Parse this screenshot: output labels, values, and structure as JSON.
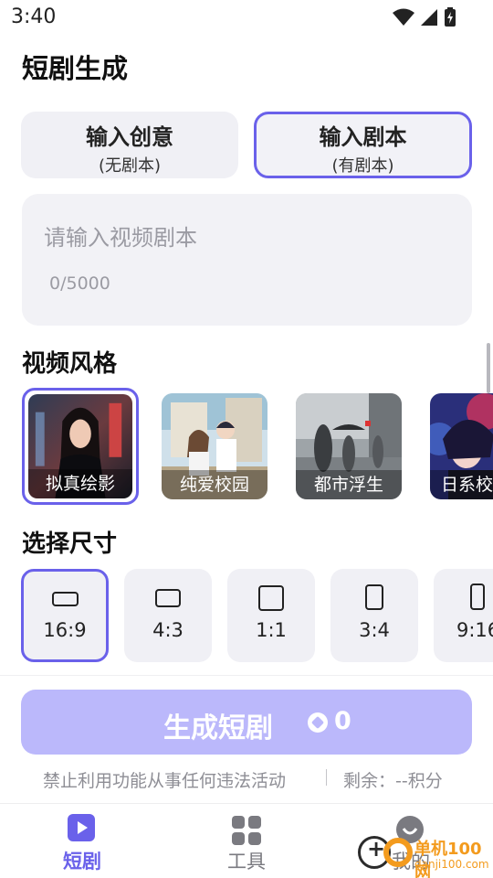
{
  "status_bar": {
    "time": "3:40"
  },
  "page": {
    "title": "短剧生成"
  },
  "mode_tabs": [
    {
      "main": "输入创意",
      "sub": "(无剧本)",
      "active": false
    },
    {
      "main": "输入剧本",
      "sub": "(有剧本)",
      "active": true
    }
  ],
  "script_input": {
    "placeholder": "请输入视频剧本",
    "char_count": "0/5000"
  },
  "style_section": {
    "title": "视频风格",
    "items": [
      {
        "label": "拟真绘影",
        "active": true
      },
      {
        "label": "纯爱校园",
        "active": false
      },
      {
        "label": "都市浮生",
        "active": false
      },
      {
        "label": "日系校",
        "active": false
      }
    ]
  },
  "size_section": {
    "title": "选择尺寸",
    "items": [
      {
        "label": "16:9",
        "active": true
      },
      {
        "label": "4:3",
        "active": false
      },
      {
        "label": "1:1",
        "active": false
      },
      {
        "label": "3:4",
        "active": false
      },
      {
        "label": "9:16",
        "active": false
      }
    ]
  },
  "generate": {
    "label": "生成短剧",
    "cost": "0"
  },
  "notice": {
    "warning": "禁止利用功能从事任何违法活动",
    "remaining": "剩余：--积分"
  },
  "bottom_nav": [
    {
      "label": "短剧",
      "icon": "play-icon",
      "active": true
    },
    {
      "label": "工具",
      "icon": "grid-icon",
      "active": false
    },
    {
      "label": "我的",
      "icon": "profile-icon",
      "active": false
    }
  ],
  "watermark": {
    "text": "单机100网",
    "url": "danji100.com"
  },
  "colors": {
    "accent": "#6a61ea",
    "generate_disabled": "#bbb8fb",
    "card_bg": "#f0f0f5"
  }
}
